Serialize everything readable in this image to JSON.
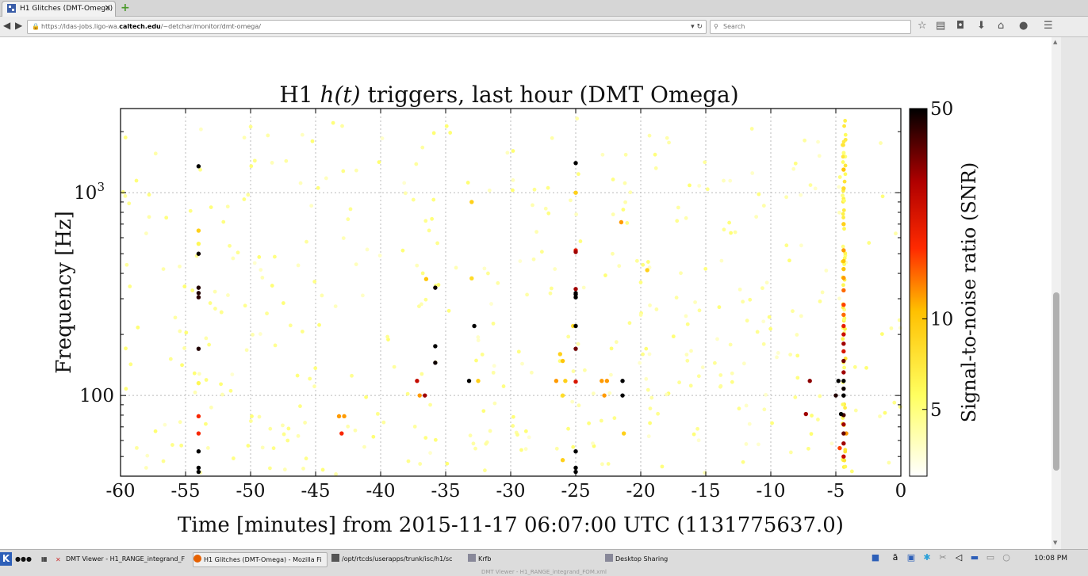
{
  "browser": {
    "tab_title": "H1 Glitches (DMT-Omega)",
    "tab_close": "✕",
    "new_tab": "+",
    "url_prefix": "https://ldas-jobs.ligo-wa.",
    "url_domain": "caltech.edu",
    "url_path": "/~detchar/monitor/dmt-omega/",
    "search_placeholder": "Search",
    "icons": [
      "star-icon",
      "reading-list-icon",
      "pocket-icon",
      "download-icon",
      "home-icon",
      "chat-icon",
      "menu-icon"
    ]
  },
  "chart_data": {
    "type": "scatter",
    "title_pre": "H1 ",
    "title_math": "h(t)",
    "title_post": " triggers, last hour (DMT Omega)",
    "xlabel": "Time [minutes] from 2015-11-17 06:07:00 UTC (1131775637.0)",
    "ylabel": "Frequency [Hz]",
    "xlim": [
      -60,
      0
    ],
    "ylim": [
      40,
      2600
    ],
    "yscale": "log",
    "xticks": [
      -60,
      -55,
      -50,
      -45,
      -40,
      -35,
      -30,
      -25,
      -20,
      -15,
      -10,
      -5,
      0
    ],
    "xtick_labels": [
      "-60",
      "-55",
      "-50",
      "-45",
      "-40",
      "-35",
      "-30",
      "-25",
      "-20",
      "-15",
      "-10",
      "-5",
      "0"
    ],
    "ytick_labels": [
      {
        "base": "10",
        "exp": "3",
        "value": 1000
      },
      {
        "base": "100",
        "exp": "",
        "value": 100
      }
    ],
    "grid": true,
    "colorbar": {
      "label": "Signal-to-noise ratio (SNR)",
      "ticks": [
        {
          "label": "50",
          "value": 50
        },
        {
          "label": "10",
          "value": 10
        },
        {
          "label": "5",
          "value": 5
        }
      ],
      "range": [
        3,
        50
      ],
      "scale": "log",
      "colormap": "hot_r"
    },
    "background_points": 430,
    "triggers": [
      {
        "t": -54,
        "f": 1350,
        "snr": 50
      },
      {
        "t": -54,
        "f": 650,
        "snr": 9
      },
      {
        "t": -54,
        "f": 560,
        "snr": 6
      },
      {
        "t": -54,
        "f": 500,
        "snr": 48
      },
      {
        "t": -54,
        "f": 340,
        "snr": 45
      },
      {
        "t": -54,
        "f": 320,
        "snr": 45
      },
      {
        "t": -54,
        "f": 305,
        "snr": 44
      },
      {
        "t": -54,
        "f": 170,
        "snr": 45
      },
      {
        "t": -54,
        "f": 115,
        "snr": 6
      },
      {
        "t": -54,
        "f": 79,
        "snr": 18
      },
      {
        "t": -54,
        "f": 65,
        "snr": 18
      },
      {
        "t": -54,
        "f": 53,
        "snr": 50
      },
      {
        "t": -54,
        "f": 44,
        "snr": 50
      },
      {
        "t": -54,
        "f": 42,
        "snr": 50
      },
      {
        "t": -43.2,
        "f": 79,
        "snr": 12
      },
      {
        "t": -42.8,
        "f": 79,
        "snr": 12
      },
      {
        "t": -43,
        "f": 65,
        "snr": 18
      },
      {
        "t": -37.2,
        "f": 118,
        "snr": 25
      },
      {
        "t": -37,
        "f": 100,
        "snr": 12
      },
      {
        "t": -36.6,
        "f": 100,
        "snr": 30
      },
      {
        "t": -36.5,
        "f": 375,
        "snr": 10
      },
      {
        "t": -35.8,
        "f": 340,
        "snr": 48
      },
      {
        "t": -35.8,
        "f": 175,
        "snr": 50
      },
      {
        "t": -35.8,
        "f": 145,
        "snr": 48
      },
      {
        "t": -33.2,
        "f": 118,
        "snr": 50
      },
      {
        "t": -33,
        "f": 900,
        "snr": 9
      },
      {
        "t": -32.8,
        "f": 220,
        "snr": 50
      },
      {
        "t": -32.5,
        "f": 118,
        "snr": 9
      },
      {
        "t": -33,
        "f": 378,
        "snr": 8
      },
      {
        "t": -26.5,
        "f": 118,
        "snr": 12
      },
      {
        "t": -26,
        "f": 148,
        "snr": 10
      },
      {
        "t": -26.2,
        "f": 160,
        "snr": 9
      },
      {
        "t": -26,
        "f": 100,
        "snr": 8
      },
      {
        "t": -25.8,
        "f": 118,
        "snr": 9
      },
      {
        "t": -26,
        "f": 48,
        "snr": 9
      },
      {
        "t": -25.2,
        "f": 220,
        "snr": 8
      },
      {
        "t": -25,
        "f": 1400,
        "snr": 50
      },
      {
        "t": -25,
        "f": 1000,
        "snr": 9
      },
      {
        "t": -25,
        "f": 520,
        "snr": 20
      },
      {
        "t": -25,
        "f": 510,
        "snr": 30
      },
      {
        "t": -25,
        "f": 335,
        "snr": 30
      },
      {
        "t": -25,
        "f": 320,
        "snr": 48
      },
      {
        "t": -25,
        "f": 315,
        "snr": 50
      },
      {
        "t": -25,
        "f": 305,
        "snr": 50
      },
      {
        "t": -25,
        "f": 220,
        "snr": 50
      },
      {
        "t": -25,
        "f": 170,
        "snr": 35
      },
      {
        "t": -25,
        "f": 117,
        "snr": 22
      },
      {
        "t": -25,
        "f": 53,
        "snr": 50
      },
      {
        "t": -25,
        "f": 44,
        "snr": 50
      },
      {
        "t": -25,
        "f": 42,
        "snr": 50
      },
      {
        "t": -23,
        "f": 118,
        "snr": 12
      },
      {
        "t": -22.6,
        "f": 118,
        "snr": 12
      },
      {
        "t": -22.8,
        "f": 100,
        "snr": 12
      },
      {
        "t": -21.5,
        "f": 715,
        "snr": 12
      },
      {
        "t": -21.4,
        "f": 118,
        "snr": 50
      },
      {
        "t": -21.4,
        "f": 100,
        "snr": 50
      },
      {
        "t": -21.3,
        "f": 65,
        "snr": 9
      },
      {
        "t": -19.5,
        "f": 415,
        "snr": 9
      },
      {
        "t": -7,
        "f": 118,
        "snr": 32
      },
      {
        "t": -7.3,
        "f": 81,
        "snr": 30
      },
      {
        "t": -5,
        "f": 100,
        "snr": 45
      },
      {
        "t": -4.8,
        "f": 118,
        "snr": 50
      },
      {
        "t": -4.6,
        "f": 81,
        "snr": 50
      },
      {
        "t": -4.4,
        "f": 100,
        "snr": 50
      },
      {
        "t": -4.4,
        "f": 1300,
        "snr": 10
      },
      {
        "t": -4.4,
        "f": 1050,
        "snr": 8
      },
      {
        "t": -4.4,
        "f": 700,
        "snr": 9
      },
      {
        "t": -4.4,
        "f": 520,
        "snr": 12
      },
      {
        "t": -4.4,
        "f": 460,
        "snr": 10
      },
      {
        "t": -4.4,
        "f": 420,
        "snr": 10
      },
      {
        "t": -4.4,
        "f": 380,
        "snr": 12
      },
      {
        "t": -4.4,
        "f": 330,
        "snr": 14
      },
      {
        "t": -4.4,
        "f": 280,
        "snr": 16
      },
      {
        "t": -4.4,
        "f": 250,
        "snr": 14
      },
      {
        "t": -4.4,
        "f": 220,
        "snr": 20
      },
      {
        "t": -4.4,
        "f": 200,
        "snr": 24
      },
      {
        "t": -4.4,
        "f": 180,
        "snr": 30
      },
      {
        "t": -4.4,
        "f": 165,
        "snr": 22
      },
      {
        "t": -4.4,
        "f": 148,
        "snr": 35
      },
      {
        "t": -4.4,
        "f": 130,
        "snr": 30
      },
      {
        "t": -4.4,
        "f": 118,
        "snr": 50
      },
      {
        "t": -4.4,
        "f": 108,
        "snr": 48
      },
      {
        "t": -4.4,
        "f": 100,
        "snr": 50
      },
      {
        "t": -4.4,
        "f": 80,
        "snr": 40
      },
      {
        "t": -4.4,
        "f": 72,
        "snr": 30
      },
      {
        "t": -4.4,
        "f": 65,
        "snr": 36
      },
      {
        "t": -4.4,
        "f": 58,
        "snr": 30
      },
      {
        "t": -4.4,
        "f": 50,
        "snr": 25
      },
      {
        "t": -4.7,
        "f": 55,
        "snr": 16
      },
      {
        "t": -4.2,
        "f": 65,
        "snr": 12
      }
    ]
  },
  "taskbar": {
    "tasks": [
      {
        "label": "DMT Viewer - H1_RANGE_integrand_F",
        "icon": "dmt-viewer-icon"
      },
      {
        "label": "H1 Glitches (DMT-Omega) - Mozilla Fi",
        "icon": "firefox-icon"
      },
      {
        "label": "/opt/rtcds/userapps/trunk/isc/h1/sc",
        "icon": "terminal-icon"
      },
      {
        "label": "Krfb",
        "icon": "krfb-icon"
      },
      {
        "label": "Desktop Sharing",
        "icon": "desktop-sharing-icon"
      }
    ],
    "clock": "10:08 PM",
    "status_line": "DMT Viewer - H1_RANGE_integrand_FOM.xml"
  }
}
